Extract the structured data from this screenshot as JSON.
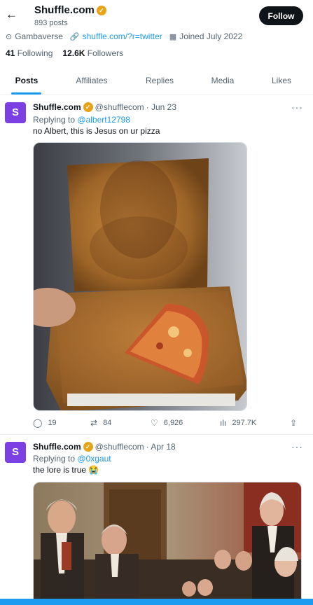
{
  "header": {
    "name": "Shuffle.com",
    "post_count": "893 posts",
    "follow_label": "Follow",
    "back_icon": "←",
    "verified_icon": "✓"
  },
  "profile": {
    "location": "Gambaverse",
    "website": "shuffle.com/?r=twitter",
    "joined": "Joined July 2022",
    "following_count": "41",
    "following_label": "Following",
    "followers_count": "12.6K",
    "followers_label": "Followers"
  },
  "tabs": [
    {
      "label": "Posts",
      "active": true
    },
    {
      "label": "Affiliates",
      "active": false
    },
    {
      "label": "Replies",
      "active": false
    },
    {
      "label": "Media",
      "active": false
    },
    {
      "label": "Likes",
      "active": false
    }
  ],
  "tweets": [
    {
      "name": "Shuffle.com",
      "handle": "@shufflecom",
      "date": "· Jun 23",
      "replying_prefix": "Replying to",
      "replying_to": "@albert12798",
      "text": "no Albert, this is Jesus on ur pizza",
      "replies": "19",
      "reposts": "84",
      "likes": "6,926",
      "views": "297.7K"
    },
    {
      "name": "Shuffle.com",
      "handle": "@shufflecom",
      "date": "· Apr 18",
      "replying_prefix": "Replying to",
      "replying_to": "@0xgaut",
      "text": "the lore is true 😭"
    }
  ],
  "colors": {
    "accent": "#1d9bf0",
    "avatar_bg": "#7b3fe4",
    "verified": "#e8a317",
    "text_secondary": "#536471"
  },
  "icons": {
    "avatar_glyph": "S",
    "more": "···",
    "location": "⊙",
    "link": "🔗",
    "calendar": "▦",
    "reply": "◯",
    "repost": "⇄",
    "like": "♡",
    "views": "ılı",
    "share": "⇪"
  }
}
